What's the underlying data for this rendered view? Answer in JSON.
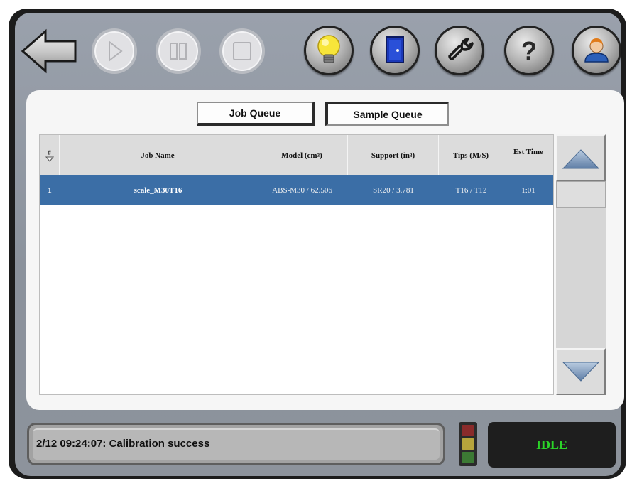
{
  "toolbar": {
    "back_icon": "back-arrow-icon",
    "buttons": [
      {
        "name": "play-button",
        "icon": "play-icon",
        "state": "disabled"
      },
      {
        "name": "pause-button",
        "icon": "pause-icon",
        "state": "disabled"
      },
      {
        "name": "stop-button",
        "icon": "stop-icon",
        "state": "disabled"
      },
      {
        "name": "lightbulb-button",
        "icon": "lightbulb-icon",
        "state": "enabled"
      },
      {
        "name": "door-button",
        "icon": "door-icon",
        "state": "enabled"
      },
      {
        "name": "wrench-button",
        "icon": "wrench-icon",
        "state": "enabled"
      },
      {
        "name": "help-button",
        "icon": "question-mark-icon",
        "state": "enabled"
      },
      {
        "name": "user-button",
        "icon": "user-icon",
        "state": "enabled"
      }
    ]
  },
  "tabs": {
    "job_queue": "Job Queue",
    "sample_queue": "Sample Queue",
    "active": "Sample Queue"
  },
  "table": {
    "headers": {
      "num": "#",
      "job_name": "Job Name",
      "model": "Model (cm",
      "model_sup": "3",
      "model_end": ")",
      "support": "Support (in",
      "support_sup": "3",
      "support_end": ")",
      "tips": "Tips (M/S)",
      "est_time": "Est Time"
    },
    "rows": [
      {
        "num": "1",
        "job_name": "scale_M30T16",
        "model": "ABS-M30 / 62.506",
        "support": "SR20 / 3.781",
        "tips": "T16 / T12",
        "est_time": "1:01",
        "selected": true
      }
    ]
  },
  "status": {
    "message": "2/12 09:24:07: Calibration success",
    "state": "IDLE",
    "state_color": "#2bd428",
    "light_colors": [
      "#8a2b2b",
      "#b7a43c",
      "#3c7a34"
    ]
  },
  "colors": {
    "selection": "#3b6ea6",
    "panel": "#9aa1ac"
  }
}
